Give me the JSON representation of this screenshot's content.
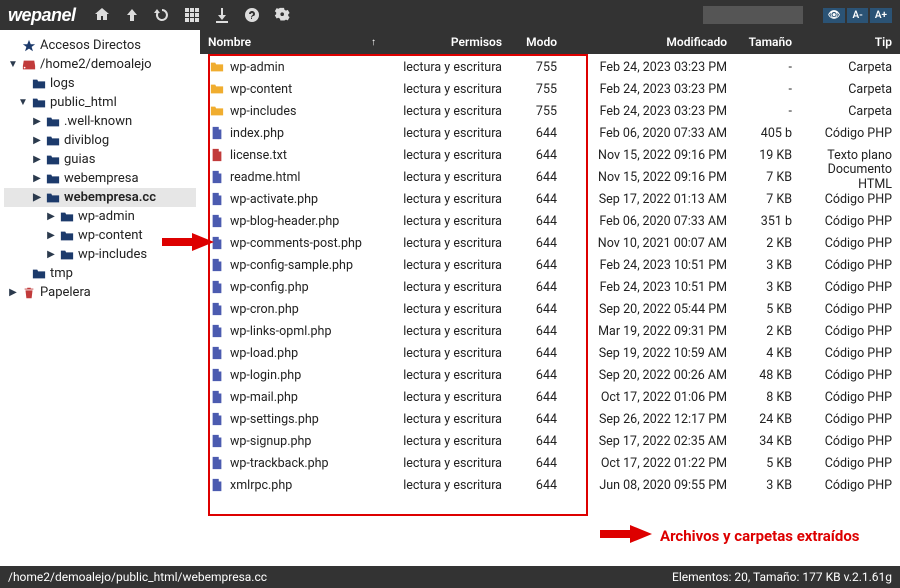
{
  "brand": "wepanel",
  "topbar_icons": [
    "home-icon",
    "up-icon",
    "refresh-icon",
    "grid-icon",
    "download-icon",
    "help-icon",
    "settings-icon"
  ],
  "search_placeholder": "",
  "right_buttons": [
    "👁",
    "A-",
    "A+"
  ],
  "sidebar": [
    {
      "caret": "none",
      "icon": "star",
      "label": "Accesos Directos",
      "lvl": 0,
      "c": "star-icon"
    },
    {
      "caret": "down",
      "icon": "hdd",
      "label": "/home2/demoalejo",
      "lvl": 0,
      "c": "hdd-icon"
    },
    {
      "caret": "none",
      "icon": "folder",
      "label": "logs",
      "lvl": 1,
      "c": "folder-blue"
    },
    {
      "caret": "down",
      "icon": "folder",
      "label": "public_html",
      "lvl": 1,
      "c": "folder-blue"
    },
    {
      "caret": "right",
      "icon": "folder",
      "label": ".well-known",
      "lvl": 2,
      "c": "folder-blue"
    },
    {
      "caret": "right",
      "icon": "folder",
      "label": "diviblog",
      "lvl": 2,
      "c": "folder-blue"
    },
    {
      "caret": "right",
      "icon": "folder",
      "label": "guias",
      "lvl": 2,
      "c": "folder-blue"
    },
    {
      "caret": "right",
      "icon": "folder",
      "label": "webempresa",
      "lvl": 2,
      "c": "folder-blue"
    },
    {
      "caret": "right",
      "icon": "folder",
      "label": "webempresa.cc",
      "lvl": 2,
      "c": "folder-blue",
      "sel": true
    },
    {
      "caret": "right",
      "icon": "folder",
      "label": "wp-admin",
      "lvl": 3,
      "c": "folder-blue"
    },
    {
      "caret": "right",
      "icon": "folder",
      "label": "wp-content",
      "lvl": 3,
      "c": "folder-blue"
    },
    {
      "caret": "right",
      "icon": "folder",
      "label": "wp-includes",
      "lvl": 3,
      "c": "folder-blue"
    },
    {
      "caret": "none",
      "icon": "folder",
      "label": "tmp",
      "lvl": 1,
      "c": "folder-blue"
    },
    {
      "caret": "right",
      "icon": "trash",
      "label": "Papelera",
      "lvl": 0,
      "c": "trash-icon"
    }
  ],
  "columns": {
    "name": "Nombre",
    "perm": "Permisos",
    "mode": "Modo",
    "mod": "Modificado",
    "size": "Tamaño",
    "type": "Tip"
  },
  "sort_indicator": "↑",
  "rows": [
    {
      "icon": "folder",
      "c": "folder-gold",
      "name": "wp-admin",
      "perm": "lectura y escritura",
      "mode": "755",
      "mod": "Feb 24, 2023 03:23 PM",
      "size": "-",
      "type": "Carpeta"
    },
    {
      "icon": "folder",
      "c": "folder-gold",
      "name": "wp-content",
      "perm": "lectura y escritura",
      "mode": "755",
      "mod": "Feb 24, 2023 03:23 PM",
      "size": "-",
      "type": "Carpeta"
    },
    {
      "icon": "folder",
      "c": "folder-gold",
      "name": "wp-includes",
      "perm": "lectura y escritura",
      "mode": "755",
      "mod": "Feb 24, 2023 03:23 PM",
      "size": "-",
      "type": "Carpeta"
    },
    {
      "icon": "file",
      "c": "file-php",
      "name": "index.php",
      "perm": "lectura y escritura",
      "mode": "644",
      "mod": "Feb 06, 2020 07:33 AM",
      "size": "405 b",
      "type": "Código PHP"
    },
    {
      "icon": "file",
      "c": "file-txt",
      "name": "license.txt",
      "perm": "lectura y escritura",
      "mode": "644",
      "mod": "Nov 15, 2022 09:16 PM",
      "size": "19 KB",
      "type": "Texto plano"
    },
    {
      "icon": "file",
      "c": "file-html",
      "name": "readme.html",
      "perm": "lectura y escritura",
      "mode": "644",
      "mod": "Nov 15, 2022 09:16 PM",
      "size": "7 KB",
      "type": "Documento HTML"
    },
    {
      "icon": "file",
      "c": "file-php",
      "name": "wp-activate.php",
      "perm": "lectura y escritura",
      "mode": "644",
      "mod": "Sep 17, 2022 01:13 AM",
      "size": "7 KB",
      "type": "Código PHP"
    },
    {
      "icon": "file",
      "c": "file-php",
      "name": "wp-blog-header.php",
      "perm": "lectura y escritura",
      "mode": "644",
      "mod": "Feb 06, 2020 07:33 AM",
      "size": "351 b",
      "type": "Código PHP"
    },
    {
      "icon": "file",
      "c": "file-php",
      "name": "wp-comments-post.php",
      "perm": "lectura y escritura",
      "mode": "644",
      "mod": "Nov 10, 2021 00:07 AM",
      "size": "2 KB",
      "type": "Código PHP"
    },
    {
      "icon": "file",
      "c": "file-php",
      "name": "wp-config-sample.php",
      "perm": "lectura y escritura",
      "mode": "644",
      "mod": "Feb 24, 2023 10:51 PM",
      "size": "3 KB",
      "type": "Código PHP"
    },
    {
      "icon": "file",
      "c": "file-php",
      "name": "wp-config.php",
      "perm": "lectura y escritura",
      "mode": "644",
      "mod": "Feb 24, 2023 10:51 PM",
      "size": "3 KB",
      "type": "Código PHP"
    },
    {
      "icon": "file",
      "c": "file-php",
      "name": "wp-cron.php",
      "perm": "lectura y escritura",
      "mode": "644",
      "mod": "Sep 20, 2022 05:44 PM",
      "size": "5 KB",
      "type": "Código PHP"
    },
    {
      "icon": "file",
      "c": "file-php",
      "name": "wp-links-opml.php",
      "perm": "lectura y escritura",
      "mode": "644",
      "mod": "Mar 19, 2022 09:31 PM",
      "size": "2 KB",
      "type": "Código PHP"
    },
    {
      "icon": "file",
      "c": "file-php",
      "name": "wp-load.php",
      "perm": "lectura y escritura",
      "mode": "644",
      "mod": "Sep 19, 2022 10:59 AM",
      "size": "4 KB",
      "type": "Código PHP"
    },
    {
      "icon": "file",
      "c": "file-php",
      "name": "wp-login.php",
      "perm": "lectura y escritura",
      "mode": "644",
      "mod": "Sep 20, 2022 00:26 AM",
      "size": "48 KB",
      "type": "Código PHP"
    },
    {
      "icon": "file",
      "c": "file-php",
      "name": "wp-mail.php",
      "perm": "lectura y escritura",
      "mode": "644",
      "mod": "Oct 17, 2022 01:06 PM",
      "size": "8 KB",
      "type": "Código PHP"
    },
    {
      "icon": "file",
      "c": "file-php",
      "name": "wp-settings.php",
      "perm": "lectura y escritura",
      "mode": "644",
      "mod": "Sep 26, 2022 12:17 PM",
      "size": "24 KB",
      "type": "Código PHP"
    },
    {
      "icon": "file",
      "c": "file-php",
      "name": "wp-signup.php",
      "perm": "lectura y escritura",
      "mode": "644",
      "mod": "Sep 17, 2022 02:35 AM",
      "size": "34 KB",
      "type": "Código PHP"
    },
    {
      "icon": "file",
      "c": "file-php",
      "name": "wp-trackback.php",
      "perm": "lectura y escritura",
      "mode": "644",
      "mod": "Oct 17, 2022 01:22 PM",
      "size": "5 KB",
      "type": "Código PHP"
    },
    {
      "icon": "file",
      "c": "file-php",
      "name": "xmlrpc.php",
      "perm": "lectura y escritura",
      "mode": "644",
      "mod": "Jun 08, 2020 09:55 PM",
      "size": "3 KB",
      "type": "Código PHP"
    }
  ],
  "annotation": "Archivos y carpetas extraídos",
  "status_left": "/home2/demoalejo/public_html/webempresa.cc",
  "status_right": "Elementos: 20, Tamaño: 177 KB v.2.1.61g"
}
